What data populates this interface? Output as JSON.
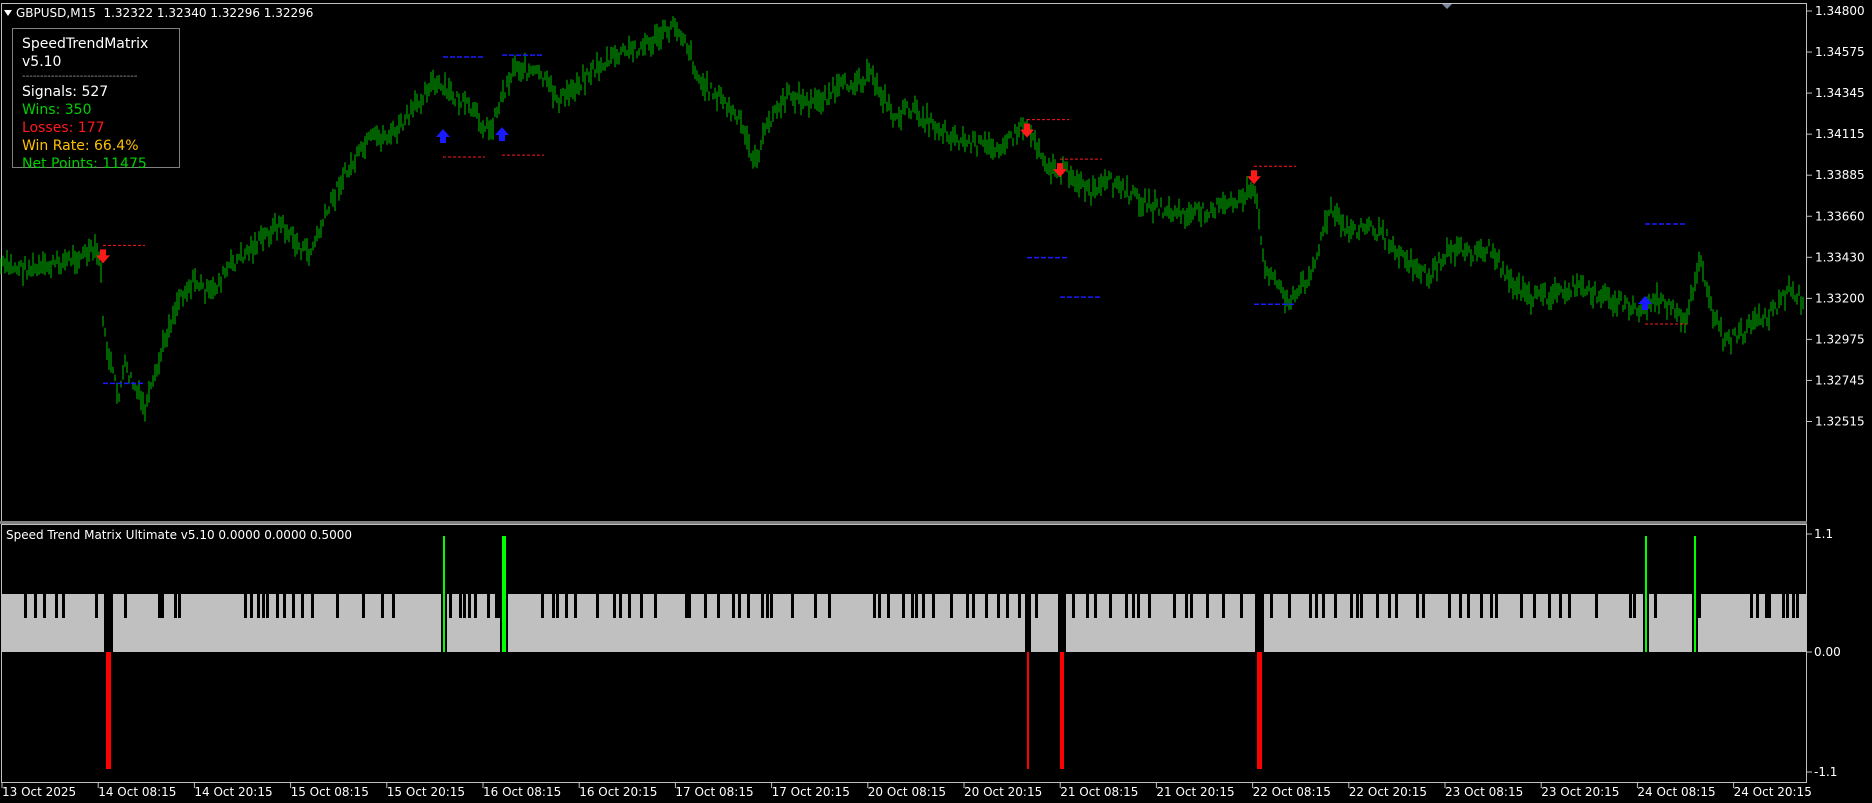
{
  "window": {
    "symbol_header": "GBPUSD,M15  1.32322 1.32340 1.32296 1.32296"
  },
  "info_panel": {
    "title": "SpeedTrendMatrix v5.10",
    "separator": "--------------------------------",
    "signals": "Signals: 527",
    "wins": "Wins: 350",
    "losses": "Losses: 177",
    "win_rate": "Win Rate: 66.4%",
    "net_points": "Net Points: 11475"
  },
  "colors": {
    "background": "#000000",
    "candles": "#00c000",
    "buy_arrow": "#1a1aff",
    "sell_arrow": "#ff1a1a",
    "wins_text": "#00d000",
    "losses_text": "#ff1a1a",
    "win_rate_text": "#ffc000",
    "histogram_neutral": "#c0c0c0",
    "histogram_buy": "#00ff00",
    "histogram_sell": "#ff0000",
    "grid_border": "#c0c0c0"
  },
  "price_axis": {
    "ticks": [
      "1.34800",
      "1.34575",
      "1.34345",
      "1.34115",
      "1.33885",
      "1.33660",
      "1.33430",
      "1.33200",
      "1.32975",
      "1.32745",
      "1.32515"
    ]
  },
  "time_axis": {
    "ticks": [
      "13 Oct 2025",
      "14 Oct 08:15",
      "14 Oct 20:15",
      "15 Oct 08:15",
      "15 Oct 20:15",
      "16 Oct 08:15",
      "16 Oct 20:15",
      "17 Oct 08:15",
      "17 Oct 20:15",
      "20 Oct 08:15",
      "20 Oct 20:15",
      "21 Oct 08:15",
      "21 Oct 20:15",
      "22 Oct 08:15",
      "22 Oct 20:15",
      "23 Oct 08:15",
      "23 Oct 20:15",
      "24 Oct 08:15",
      "24 Oct 20:15"
    ]
  },
  "indicator": {
    "header": "Speed Trend Matrix Ultimate v5.10 0.0000 0.0000 0.5000",
    "axis_ticks": [
      "1.1",
      "0.00",
      "-1.1"
    ]
  },
  "chart_data": {
    "type": "candlestick",
    "title": "GBPUSD,M15",
    "ylim": [
      1.3245,
      1.3482
    ],
    "price_path": [
      [
        0,
        1.3338
      ],
      [
        40,
        1.3336
      ],
      [
        70,
        1.3342
      ],
      [
        95,
        1.3346
      ],
      [
        100,
        1.3342
      ],
      [
        104,
        1.33
      ],
      [
        110,
        1.3285
      ],
      [
        118,
        1.3265
      ],
      [
        125,
        1.3282
      ],
      [
        135,
        1.327
      ],
      [
        145,
        1.3258
      ],
      [
        155,
        1.3275
      ],
      [
        165,
        1.3298
      ],
      [
        180,
        1.3322
      ],
      [
        195,
        1.333
      ],
      [
        210,
        1.3322
      ],
      [
        230,
        1.3338
      ],
      [
        260,
        1.3352
      ],
      [
        280,
        1.3362
      ],
      [
        300,
        1.3348
      ],
      [
        310,
        1.3345
      ],
      [
        320,
        1.3358
      ],
      [
        340,
        1.3385
      ],
      [
        370,
        1.3408
      ],
      [
        395,
        1.3412
      ],
      [
        410,
        1.3422
      ],
      [
        430,
        1.344
      ],
      [
        450,
        1.3434
      ],
      [
        470,
        1.3425
      ],
      [
        490,
        1.3413
      ],
      [
        500,
        1.343
      ],
      [
        515,
        1.345
      ],
      [
        540,
        1.3444
      ],
      [
        560,
        1.343
      ],
      [
        590,
        1.3446
      ],
      [
        620,
        1.3456
      ],
      [
        650,
        1.3462
      ],
      [
        675,
        1.3472
      ],
      [
        685,
        1.3465
      ],
      [
        700,
        1.344
      ],
      [
        720,
        1.3432
      ],
      [
        740,
        1.3418
      ],
      [
        755,
        1.3396
      ],
      [
        770,
        1.342
      ],
      [
        790,
        1.3434
      ],
      [
        810,
        1.3428
      ],
      [
        830,
        1.3434
      ],
      [
        850,
        1.344
      ],
      [
        870,
        1.3444
      ],
      [
        880,
        1.3436
      ],
      [
        895,
        1.342
      ],
      [
        910,
        1.3426
      ],
      [
        930,
        1.3418
      ],
      [
        960,
        1.3408
      ],
      [
        990,
        1.3404
      ],
      [
        1010,
        1.3408
      ],
      [
        1025,
        1.3418
      ],
      [
        1035,
        1.3408
      ],
      [
        1050,
        1.3392
      ],
      [
        1070,
        1.339
      ],
      [
        1090,
        1.3378
      ],
      [
        1110,
        1.3385
      ],
      [
        1130,
        1.3378
      ],
      [
        1150,
        1.3372
      ],
      [
        1170,
        1.3368
      ],
      [
        1190,
        1.3366
      ],
      [
        1210,
        1.337
      ],
      [
        1230,
        1.3372
      ],
      [
        1250,
        1.338
      ],
      [
        1258,
        1.3372
      ],
      [
        1262,
        1.3342
      ],
      [
        1275,
        1.333
      ],
      [
        1290,
        1.3318
      ],
      [
        1300,
        1.3325
      ],
      [
        1315,
        1.334
      ],
      [
        1330,
        1.337
      ],
      [
        1345,
        1.3358
      ],
      [
        1370,
        1.336
      ],
      [
        1390,
        1.3352
      ],
      [
        1410,
        1.334
      ],
      [
        1430,
        1.3332
      ],
      [
        1450,
        1.3348
      ],
      [
        1470,
        1.3345
      ],
      [
        1490,
        1.3348
      ],
      [
        1510,
        1.333
      ],
      [
        1530,
        1.332
      ],
      [
        1550,
        1.3322
      ],
      [
        1575,
        1.3326
      ],
      [
        1600,
        1.3322
      ],
      [
        1620,
        1.3318
      ],
      [
        1640,
        1.3312
      ],
      [
        1655,
        1.332
      ],
      [
        1670,
        1.3315
      ],
      [
        1685,
        1.3305
      ],
      [
        1695,
        1.333
      ],
      [
        1700,
        1.3346
      ],
      [
        1710,
        1.3315
      ],
      [
        1725,
        1.3295
      ],
      [
        1745,
        1.3302
      ],
      [
        1770,
        1.3312
      ],
      [
        1790,
        1.3325
      ],
      [
        1805,
        1.3318
      ]
    ],
    "signals": [
      {
        "type": "sell",
        "bar_x": 103,
        "price": 1.3344
      },
      {
        "type": "buy",
        "bar_x": 443,
        "price": 1.3411
      },
      {
        "type": "buy",
        "bar_x": 502,
        "price": 1.3412
      },
      {
        "type": "sell",
        "bar_x": 1027,
        "price": 1.3414
      },
      {
        "type": "sell",
        "bar_x": 1060,
        "price": 1.3392
      },
      {
        "type": "sell",
        "bar_x": 1254,
        "price": 1.3388
      },
      {
        "type": "buy",
        "bar_x": 1645,
        "price": 1.3318
      }
    ],
    "histogram_gaps_x": [
      24,
      34,
      43,
      55,
      62,
      95,
      104,
      124,
      158,
      161,
      174,
      178,
      244,
      250,
      257,
      262,
      266,
      276,
      283,
      292,
      301,
      311,
      336,
      362,
      381,
      392,
      449,
      459,
      463,
      468,
      474,
      487,
      495,
      498,
      541,
      552,
      556,
      565,
      574,
      596,
      613,
      619,
      628,
      640,
      654,
      685,
      688,
      704,
      717,
      732,
      738,
      747,
      761,
      766,
      770,
      791,
      814,
      828,
      873,
      878,
      887,
      902,
      911,
      915,
      922,
      932,
      950,
      966,
      972,
      985,
      997,
      1006,
      1018,
      1035,
      1063,
      1072,
      1086,
      1094,
      1109,
      1125,
      1132,
      1137,
      1148,
      1173,
      1185,
      1190,
      1206,
      1222,
      1240,
      1257,
      1270,
      1288,
      1309,
      1315,
      1322,
      1334,
      1350,
      1356,
      1360,
      1376,
      1388,
      1395,
      1416,
      1422,
      1448,
      1459,
      1467,
      1480,
      1490,
      1495,
      1520,
      1533,
      1548,
      1559,
      1568,
      1595,
      1629,
      1633,
      1643,
      1654,
      1698,
      1750,
      1756,
      1765,
      1768,
      1782,
      1786,
      1792,
      1796
    ],
    "histogram_spikes": [
      {
        "type": "sell",
        "x": 106,
        "w": 5
      },
      {
        "type": "buy",
        "x": 443,
        "w": 2
      },
      {
        "type": "buy",
        "x": 502,
        "w": 4
      },
      {
        "type": "sell",
        "x": 1027,
        "w": 2
      },
      {
        "type": "sell",
        "x": 1060,
        "w": 4
      },
      {
        "type": "sell",
        "x": 1257,
        "w": 5
      },
      {
        "type": "buy",
        "x": 1645,
        "w": 2
      },
      {
        "type": "buy",
        "x": 1694,
        "w": 2
      }
    ]
  }
}
